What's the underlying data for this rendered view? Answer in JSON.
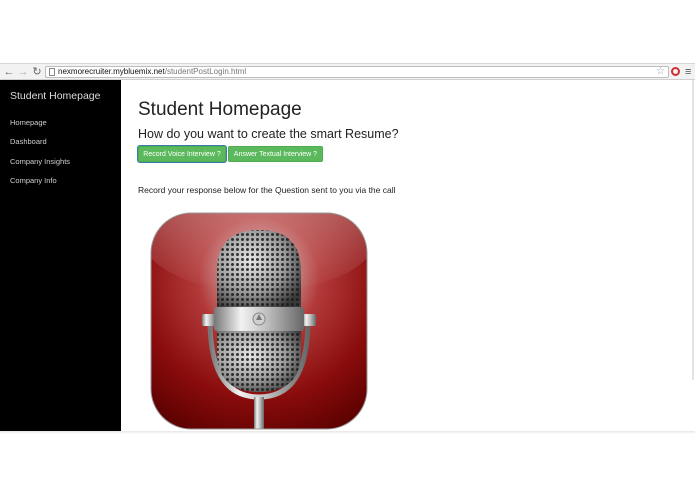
{
  "browser": {
    "url_host": "nexmorecruiter.mybluemix.net",
    "url_path": "/studentPostLogin.html",
    "icons": [
      "back-arrow-icon",
      "forward-arrow-icon",
      "reload-icon",
      "page-icon",
      "star-icon",
      "extension-icon",
      "menu-icon"
    ]
  },
  "sidebar": {
    "title": "Student Homepage",
    "items": [
      {
        "label": "Homepage"
      },
      {
        "label": "Dashboard"
      },
      {
        "label": "Company Insights"
      },
      {
        "label": "Company Info"
      }
    ]
  },
  "main": {
    "title": "Student Homepage",
    "question": "How do you want to create the smart Resume?",
    "buttons": {
      "voice": "Record Voice Interview ?",
      "text": "Answer Textual Interview ?"
    },
    "instruction": "Record your response below for the Question sent to you via the call",
    "image_icon": "microphone-icon"
  },
  "colors": {
    "sidebar_bg": "#000000",
    "button_green": "#5cb85c",
    "mic_red": "#8b0000"
  }
}
